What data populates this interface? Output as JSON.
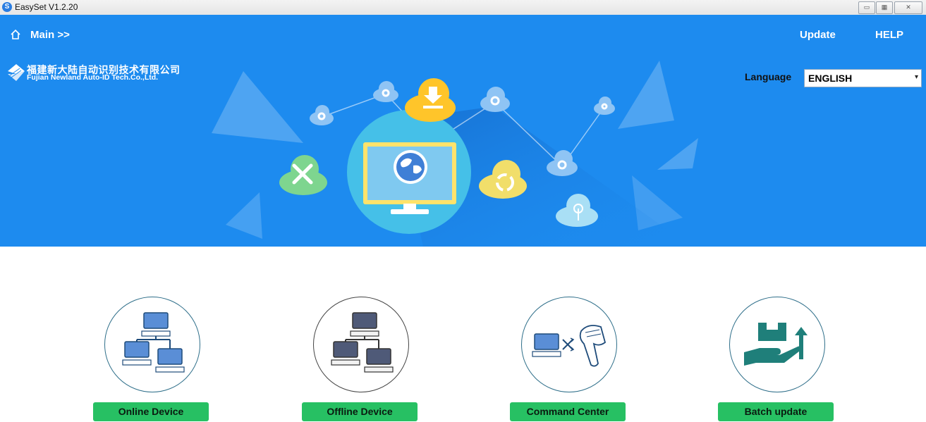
{
  "window": {
    "title": "EasySet V1.2.20",
    "controls": [
      "minimize",
      "restore",
      "close"
    ]
  },
  "header": {
    "breadcrumb": "Main >>",
    "update_label": "Update",
    "help_label": "HELP"
  },
  "logo": {
    "chinese_name": "福建新大陆自动识别技术有限公司",
    "english_name": "Fujian Newland Auto-ID Tech.Co.,Ltd."
  },
  "language": {
    "label": "Language",
    "selected": "ENGLISH"
  },
  "features": [
    {
      "label": "Online Device",
      "icon": "network-computers-icon"
    },
    {
      "label": "Offline Device",
      "icon": "offline-network-icon"
    },
    {
      "label": "Command Center",
      "icon": "computer-scanner-icon"
    },
    {
      "label": "Batch update",
      "icon": "batch-update-icon"
    }
  ],
  "colors": {
    "banner": "#1d8bef",
    "button": "#27c063",
    "icon_teal": "#1f7f7a"
  }
}
